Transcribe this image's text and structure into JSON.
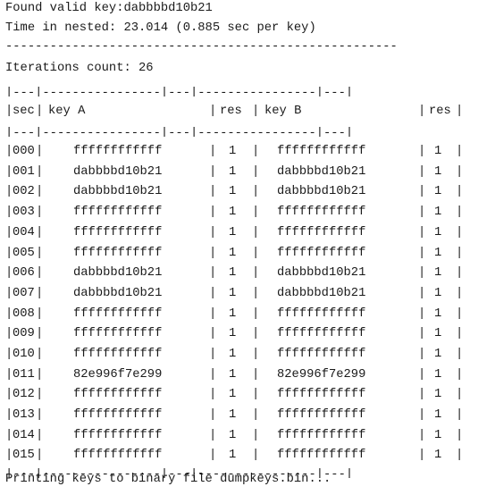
{
  "terminal": {
    "line1": "Found valid key:dabbbbd10b21",
    "line2": "Time in nested: 23.014 (0.885 sec per key)",
    "line3": "-----------------------------------------------------",
    "line4": "Iterations count: 26",
    "table_top_border": "|---|----------------|---|----------------|---|",
    "table_header_border": "|---|----------------|---|----------------|---|",
    "table_bottom_border": "|---|----------------|---|----------------|---|",
    "table_header": {
      "sec": "sec",
      "key_a": "key A",
      "res_a": "res",
      "key_b": "key B",
      "res_b": "res"
    },
    "rows": [
      {
        "sec": "000",
        "key_a": "ffffffffffff",
        "res_a": "1",
        "key_b": "ffffffffffff",
        "res_b": "1"
      },
      {
        "sec": "001",
        "key_a": "dabbbbd10b21",
        "res_a": "1",
        "key_b": "dabbbbd10b21",
        "res_b": "1"
      },
      {
        "sec": "002",
        "key_a": "dabbbbd10b21",
        "res_a": "1",
        "key_b": "dabbbbd10b21",
        "res_b": "1"
      },
      {
        "sec": "003",
        "key_a": "ffffffffffff",
        "res_a": "1",
        "key_b": "ffffffffffff",
        "res_b": "1"
      },
      {
        "sec": "004",
        "key_a": "ffffffffffff",
        "res_a": "1",
        "key_b": "ffffffffffff",
        "res_b": "1"
      },
      {
        "sec": "005",
        "key_a": "ffffffffffff",
        "res_a": "1",
        "key_b": "ffffffffffff",
        "res_b": "1"
      },
      {
        "sec": "006",
        "key_a": "dabbbbd10b21",
        "res_a": "1",
        "key_b": "dabbbbd10b21",
        "res_b": "1"
      },
      {
        "sec": "007",
        "key_a": "dabbbbd10b21",
        "res_a": "1",
        "key_b": "dabbbbd10b21",
        "res_b": "1"
      },
      {
        "sec": "008",
        "key_a": "ffffffffffff",
        "res_a": "1",
        "key_b": "ffffffffffff",
        "res_b": "1"
      },
      {
        "sec": "009",
        "key_a": "ffffffffffff",
        "res_a": "1",
        "key_b": "ffffffffffff",
        "res_b": "1"
      },
      {
        "sec": "010",
        "key_a": "ffffffffffff",
        "res_a": "1",
        "key_b": "ffffffffffff",
        "res_b": "1"
      },
      {
        "sec": "011",
        "key_a": "82e996f7e299",
        "res_a": "1",
        "key_b": "82e996f7e299",
        "res_b": "1"
      },
      {
        "sec": "012",
        "key_a": "ffffffffffff",
        "res_a": "1",
        "key_b": "ffffffffffff",
        "res_b": "1"
      },
      {
        "sec": "013",
        "key_a": "ffffffffffff",
        "res_a": "1",
        "key_b": "ffffffffffff",
        "res_b": "1"
      },
      {
        "sec": "014",
        "key_a": "ffffffffffff",
        "res_a": "1",
        "key_b": "ffffffffffff",
        "res_b": "1"
      },
      {
        "sec": "015",
        "key_a": "ffffffffffff",
        "res_a": "1",
        "key_b": "ffffffffffff",
        "res_b": "1"
      }
    ],
    "footer": "Printing keys to binary file dumpkeys.bin..."
  }
}
